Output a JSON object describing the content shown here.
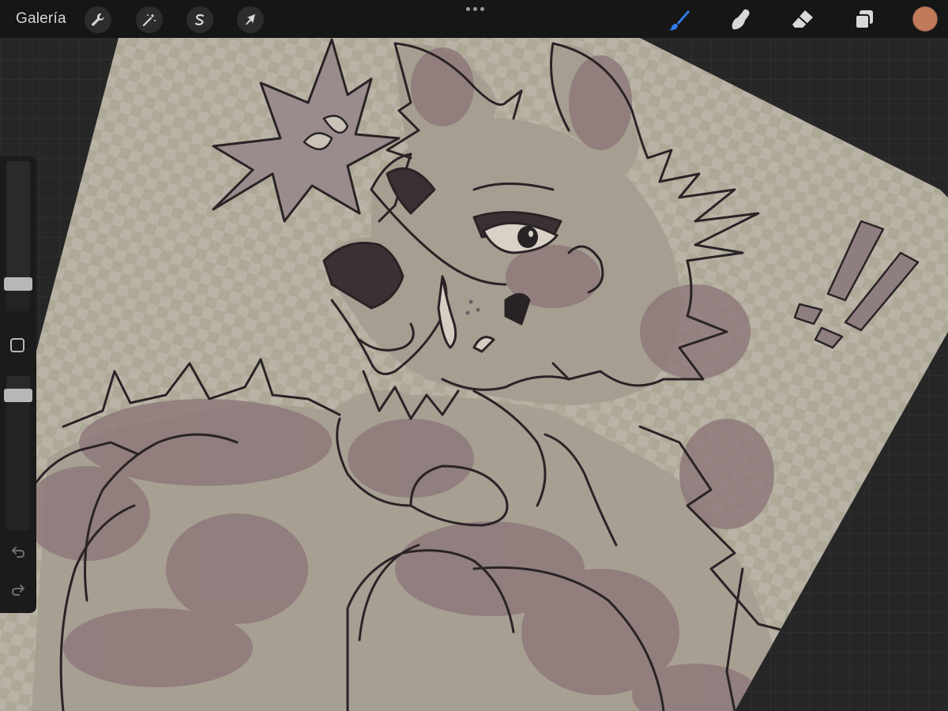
{
  "app": {
    "gallery_label": "Galería"
  },
  "toolbar": {
    "left_tools": [
      {
        "name": "actions",
        "icon": "wrench-icon"
      },
      {
        "name": "adjustments",
        "icon": "magic-wand-icon"
      },
      {
        "name": "selection",
        "icon": "selection-s-icon"
      },
      {
        "name": "transform",
        "icon": "arrow-cursor-icon"
      }
    ],
    "right_tools": [
      {
        "name": "brush",
        "icon": "brush-icon",
        "active": true
      },
      {
        "name": "smudge",
        "icon": "smudge-finger-icon",
        "active": false
      },
      {
        "name": "eraser",
        "icon": "eraser-icon",
        "active": false
      },
      {
        "name": "layers",
        "icon": "layers-icon",
        "active": false
      }
    ],
    "more_icon": "more-dots-icon",
    "active_color": "#c27b5a",
    "active_tool_color": "#2f7ef0"
  },
  "sidebar": {
    "brush_size_level": 0.15,
    "opacity_level": 0.91,
    "modify_icon": "square-icon",
    "undo_icon": "undo-icon",
    "redo_icon": "redo-icon"
  },
  "canvas": {
    "artwork": "sketch-wolf-character",
    "paper_color": "#b7b1a4",
    "line_color": "#2a2326",
    "shade_color": "#8a7377"
  }
}
